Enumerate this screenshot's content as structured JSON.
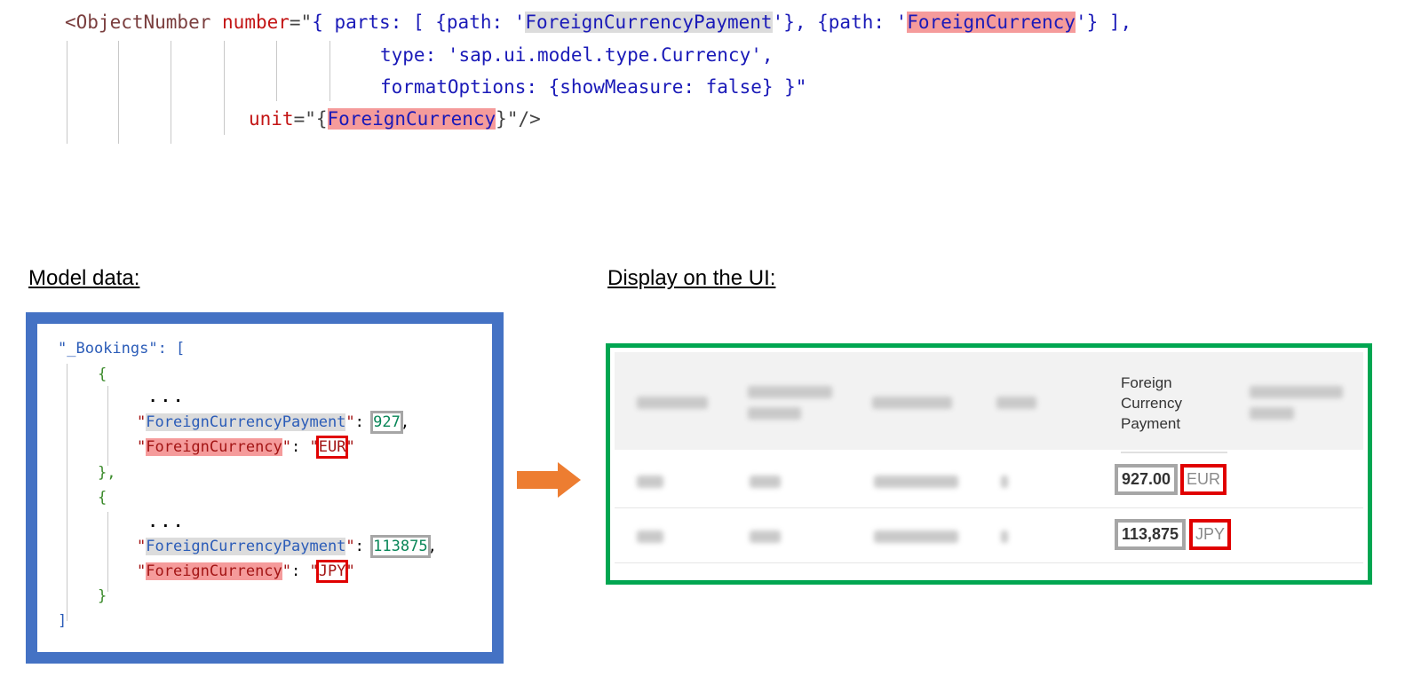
{
  "code": {
    "line1": {
      "open_tag": "<ObjectNumber",
      "attr_number": "number",
      "eq": "=\"",
      "part1": "{ parts: [ {path: '",
      "path1": "ForeignCurrencyPayment",
      "part2": "'}, {path: '",
      "path2": "ForeignCurrency",
      "part3": "'} ],"
    },
    "line2": "type: 'sap.ui.model.type.Currency',",
    "line3": "formatOptions: {showMeasure: false} }\"",
    "line4": {
      "attr_unit": "unit",
      "eq": "=\"{",
      "binding": "ForeignCurrency",
      "close": "}\"/>"
    }
  },
  "captions": {
    "model": "Model data:",
    "ui": "Display on the UI:"
  },
  "model_json": {
    "root_key": "\"_Bookings\": [",
    "open_brace": "{",
    "ellipsis": "...",
    "close_brace_comma": "},",
    "close_brace": "}",
    "close_bracket": "]",
    "payment_key": "ForeignCurrencyPayment",
    "currency_key": "ForeignCurrency",
    "records": [
      {
        "payment": "927",
        "currency": "EUR"
      },
      {
        "payment": "113875",
        "currency": "JPY"
      }
    ]
  },
  "ui_table": {
    "column_header": [
      "Foreign",
      "Currency",
      "Payment"
    ],
    "rows": [
      {
        "amount": "927.00",
        "unit": "EUR"
      },
      {
        "amount": "113,875",
        "unit": "JPY"
      }
    ]
  },
  "colors": {
    "model_border": "#4472c4",
    "ui_border": "#00a651",
    "arrow": "#ed7d31",
    "highlight_red": "#f59b9b",
    "highlight_gray": "#dcdcdc",
    "box_red": "#e00000",
    "box_gray": "#a6a6a6"
  }
}
